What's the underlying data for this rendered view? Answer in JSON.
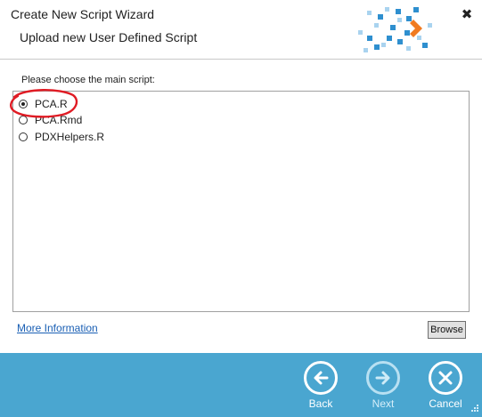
{
  "window": {
    "title": "Create New Script Wizard",
    "subtitle": "Upload new User Defined Script",
    "close_glyph": "✖"
  },
  "main": {
    "prompt": "Please choose the main script:",
    "options": [
      {
        "label": "PCA.R",
        "checked": true
      },
      {
        "label": "PCA.Rmd",
        "checked": false
      },
      {
        "label": "PDXHelpers.R",
        "checked": false
      }
    ],
    "more_info_link": "More Information",
    "browse_label": "Browse"
  },
  "footer": {
    "back_label": "Back",
    "next_label": "Next",
    "cancel_label": "Cancel"
  },
  "colors": {
    "footer_bg": "#4aa6d0",
    "logo_blue": "#2e8fcf",
    "logo_light": "#a9d3ef",
    "logo_arrow": "#f07b21",
    "annotation_red": "#e01b24",
    "link": "#1a5fb4"
  },
  "icons": {
    "back": "arrow-left-circle-icon",
    "next": "arrow-right-circle-icon",
    "cancel": "close-circle-icon",
    "logo": "pixel-mosaic-logo"
  }
}
